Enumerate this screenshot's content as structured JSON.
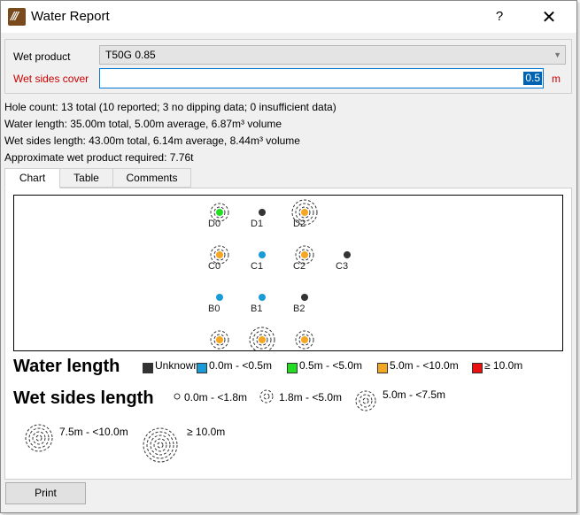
{
  "window": {
    "title": "Water Report",
    "help_label": "?",
    "close_label": "✕"
  },
  "form": {
    "product_label": "Wet product",
    "product_value": "T50G 0.85",
    "cover_label": "Wet sides cover",
    "cover_value": "0.5",
    "cover_unit": "m"
  },
  "summary": {
    "hole_count": "Hole count: 13 total (10 reported; 3 no dipping data; 0 insufficient data)",
    "water_length": "Water length: 35.00m total, 5.00m average, 6.87m³ volume",
    "wet_sides_length": "Wet sides length: 43.00m total, 6.14m average, 8.44m³ volume",
    "wet_product": "Approximate wet product required: 7.76t"
  },
  "tabs": [
    "Chart",
    "Table",
    "Comments"
  ],
  "chart": {
    "holes": [
      {
        "label": "D0",
        "water_class": 2,
        "wet_class": 2
      },
      {
        "label": "D1",
        "water_class": 0,
        "wet_class": null
      },
      {
        "label": "D2",
        "water_class": 3,
        "wet_class": 3
      },
      {
        "label": "C0",
        "water_class": 3,
        "wet_class": 2
      },
      {
        "label": "C1",
        "water_class": 1,
        "wet_class": null
      },
      {
        "label": "C2",
        "water_class": 3,
        "wet_class": 2
      },
      {
        "label": "C3",
        "water_class": 0,
        "wet_class": null
      },
      {
        "label": "B0",
        "water_class": 1,
        "wet_class": null
      },
      {
        "label": "B1",
        "water_class": 1,
        "wet_class": null
      },
      {
        "label": "B2",
        "water_class": 0,
        "wet_class": null
      },
      {
        "label": "",
        "water_class": 3,
        "wet_class": 2
      },
      {
        "label": "",
        "water_class": 3,
        "wet_class": 3
      },
      {
        "label": "",
        "water_class": 3,
        "wet_class": 2
      }
    ]
  },
  "legend": {
    "water_title": "Water length",
    "water_items": [
      {
        "label": "Unknown",
        "color": "#333333"
      },
      {
        "label": "0.0m - <0.5m",
        "color": "#1a9ad6"
      },
      {
        "label": "0.5m - <5.0m",
        "color": "#22dd22"
      },
      {
        "label": "5.0m - <10.0m",
        "color": "#f5a623"
      },
      {
        "label": "≥ 10.0m",
        "color": "#e81010"
      }
    ],
    "wet_title": "Wet sides length",
    "wet_items": [
      {
        "label": "0.0m - <1.8m",
        "rings": 1
      },
      {
        "label": "1.8m - <5.0m",
        "rings": 2
      },
      {
        "label": "5.0m - <7.5m",
        "rings": 3
      },
      {
        "label": "7.5m - <10.0m",
        "rings": 4
      },
      {
        "label": "≥ 10.0m",
        "rings": 5
      }
    ]
  },
  "footer": {
    "print_label": "Print"
  }
}
